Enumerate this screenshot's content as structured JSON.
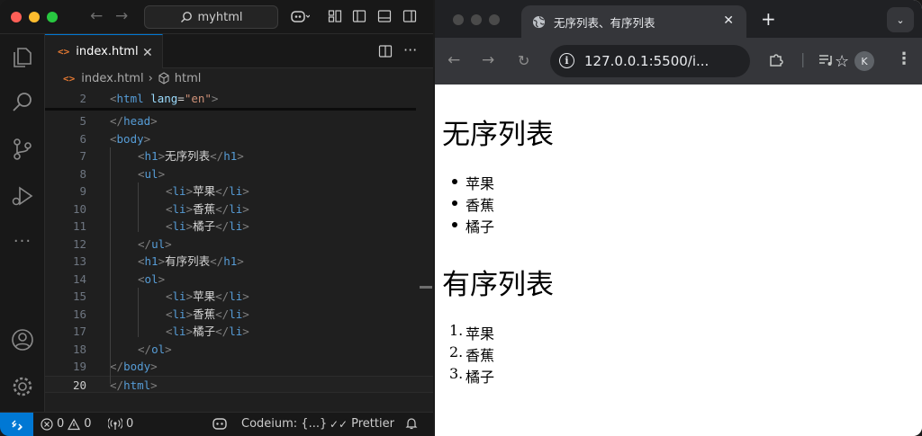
{
  "vscode": {
    "search": "myhtml",
    "tab": {
      "label": "index.html"
    },
    "breadcrumb": {
      "file": "index.html",
      "symbol": "html"
    },
    "code_lines": [
      {
        "num": "2",
        "indent": 0,
        "html": "<span class='ang'>&lt;</span><span class='tag'>html</span> <span class='attr'>lang</span><span class='txt'>=</span><span class='str'>\"en\"</span><span class='ang'>&gt;</span>"
      },
      {
        "num": "5",
        "indent": 0,
        "html": "<span class='ang'>&lt;/</span><span class='tag'>head</span><span class='ang'>&gt;</span>"
      },
      {
        "num": "6",
        "indent": 0,
        "html": "<span class='ang'>&lt;</span><span class='tag'>body</span><span class='ang'>&gt;</span>"
      },
      {
        "num": "7",
        "indent": 1,
        "html": "<span class='ang'>&lt;</span><span class='tag'>h1</span><span class='ang'>&gt;</span><span class='txt'>无序列表</span><span class='ang'>&lt;/</span><span class='tag'>h1</span><span class='ang'>&gt;</span>"
      },
      {
        "num": "8",
        "indent": 1,
        "html": "<span class='ang'>&lt;</span><span class='tag'>ul</span><span class='ang'>&gt;</span>"
      },
      {
        "num": "9",
        "indent": 2,
        "html": "<span class='ang'>&lt;</span><span class='tag'>li</span><span class='ang'>&gt;</span><span class='txt'>苹果</span><span class='ang'>&lt;/</span><span class='tag'>li</span><span class='ang'>&gt;</span>"
      },
      {
        "num": "10",
        "indent": 2,
        "html": "<span class='ang'>&lt;</span><span class='tag'>li</span><span class='ang'>&gt;</span><span class='txt'>香蕉</span><span class='ang'>&lt;/</span><span class='tag'>li</span><span class='ang'>&gt;</span>"
      },
      {
        "num": "11",
        "indent": 2,
        "html": "<span class='ang'>&lt;</span><span class='tag'>li</span><span class='ang'>&gt;</span><span class='txt'>橘子</span><span class='ang'>&lt;/</span><span class='tag'>li</span><span class='ang'>&gt;</span>"
      },
      {
        "num": "12",
        "indent": 1,
        "html": "<span class='ang'>&lt;/</span><span class='tag'>ul</span><span class='ang'>&gt;</span>"
      },
      {
        "num": "13",
        "indent": 1,
        "html": "<span class='ang'>&lt;</span><span class='tag'>h1</span><span class='ang'>&gt;</span><span class='txt'>有序列表</span><span class='ang'>&lt;/</span><span class='tag'>h1</span><span class='ang'>&gt;</span>"
      },
      {
        "num": "14",
        "indent": 1,
        "html": "<span class='ang'>&lt;</span><span class='tag'>ol</span><span class='ang'>&gt;</span>"
      },
      {
        "num": "15",
        "indent": 2,
        "html": "<span class='ang'>&lt;</span><span class='tag'>li</span><span class='ang'>&gt;</span><span class='txt'>苹果</span><span class='ang'>&lt;/</span><span class='tag'>li</span><span class='ang'>&gt;</span>"
      },
      {
        "num": "16",
        "indent": 2,
        "html": "<span class='ang'>&lt;</span><span class='tag'>li</span><span class='ang'>&gt;</span><span class='txt'>香蕉</span><span class='ang'>&lt;/</span><span class='tag'>li</span><span class='ang'>&gt;</span>"
      },
      {
        "num": "17",
        "indent": 2,
        "html": "<span class='ang'>&lt;</span><span class='tag'>li</span><span class='ang'>&gt;</span><span class='txt'>橘子</span><span class='ang'>&lt;/</span><span class='tag'>li</span><span class='ang'>&gt;</span>"
      },
      {
        "num": "18",
        "indent": 1,
        "html": "<span class='ang'>&lt;/</span><span class='tag'>ol</span><span class='ang'>&gt;</span>"
      },
      {
        "num": "19",
        "indent": 0,
        "html": "<span class='ang'>&lt;/</span><span class='tag'>body</span><span class='ang'>&gt;</span>"
      },
      {
        "num": "20",
        "indent": 0,
        "html": "<span class='ang'>&lt;/</span><span class='tag'>html</span><span class='ang'>&gt;</span>",
        "current": true
      }
    ],
    "status": {
      "errors": "0",
      "warnings": "0",
      "ports": "0",
      "codeium": "Codeium: {...}",
      "prettier": "Prettier"
    }
  },
  "browser": {
    "tab_title": "无序列表、有序列表",
    "url": "127.0.0.1:5500/i...",
    "avatar_letter": "K",
    "page": {
      "h1_unordered": "无序列表",
      "ul_items": [
        "苹果",
        "香蕉",
        "橘子"
      ],
      "h1_ordered": "有序列表",
      "ol_items": [
        "苹果",
        "香蕉",
        "橘子"
      ]
    }
  },
  "colors": {
    "accent": "#0078d4",
    "tag": "#569cd6",
    "attr": "#9cdcfe",
    "string": "#ce9178"
  }
}
